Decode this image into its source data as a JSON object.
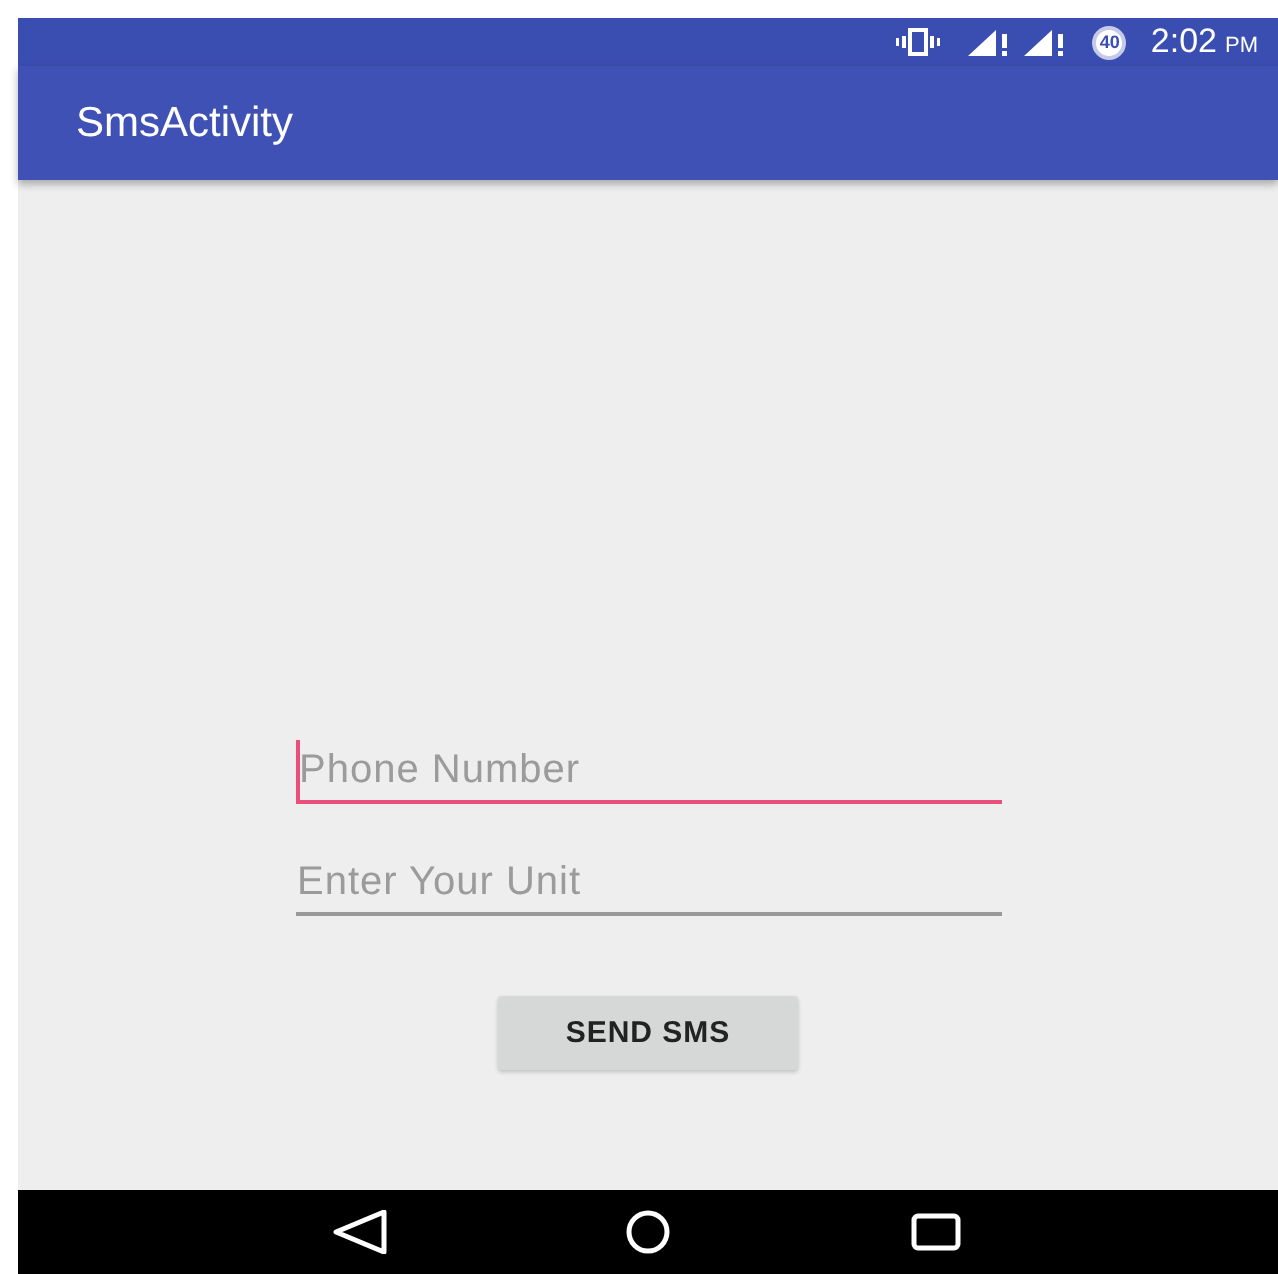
{
  "status_bar": {
    "battery": "40",
    "time": "2:02",
    "meridiem": "PM"
  },
  "app_bar": {
    "title": "SmsActivity"
  },
  "fields": [
    {
      "placeholder": "Phone Number",
      "focused": true
    },
    {
      "placeholder": "Enter Your Unit",
      "focused": false
    }
  ],
  "button": {
    "label": "SEND SMS"
  }
}
